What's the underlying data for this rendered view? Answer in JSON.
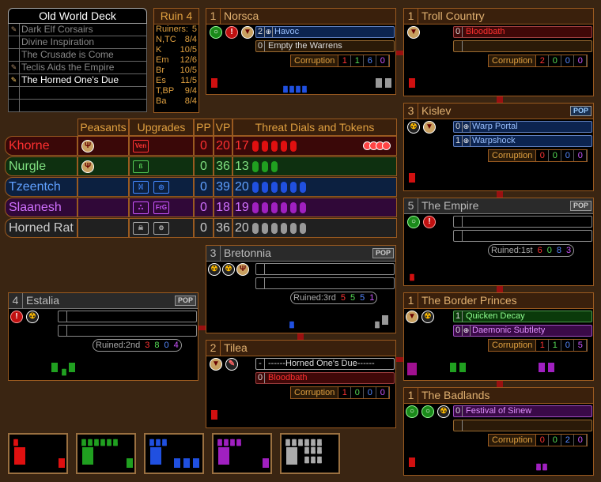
{
  "deck": {
    "title": "Old World Deck",
    "cards": [
      "Dark Elf Corsairs",
      "Divine Inspiration",
      "The Crusade is Come",
      "Teclis Aids the Empire",
      "The Horned One's Due",
      "",
      ""
    ]
  },
  "ruin": {
    "title": "Ruin 4",
    "rows": [
      [
        "Ruiners:",
        "5"
      ],
      [
        "N,TC",
        "8/4"
      ],
      [
        "K",
        "10/5"
      ],
      [
        "Em",
        "12/6"
      ],
      [
        "Br",
        "10/5"
      ],
      [
        "Es",
        "11/5"
      ],
      [
        "T,BP",
        "9/4"
      ],
      [
        "Ba",
        "8/4"
      ]
    ]
  },
  "table": {
    "headers": [
      "Peasants",
      "Upgrades",
      "PP",
      "VP",
      "Threat Dials and Tokens"
    ],
    "rows": [
      {
        "name": "Khorne",
        "pp": "0",
        "vp": "20",
        "threat": "17",
        "color": "#ff3030",
        "bg": "#3a0808",
        "up": [
          "Ven",
          ""
        ]
      },
      {
        "name": "Nurgle",
        "pp": "0",
        "vp": "36",
        "threat": "13",
        "color": "#80e080",
        "bg": "#0e3010",
        "up": [
          "",
          ""
        ]
      },
      {
        "name": "Tzeentch",
        "pp": "0",
        "vp": "39",
        "threat": "20",
        "color": "#60a0ff",
        "bg": "#0c2040",
        "up": [
          "",
          ""
        ]
      },
      {
        "name": "Slaanesh",
        "pp": "0",
        "vp": "18",
        "threat": "19",
        "color": "#d070ff",
        "bg": "#300838",
        "up": [
          "",
          "FrG"
        ]
      },
      {
        "name": "Horned Rat",
        "pp": "0",
        "vp": "36",
        "threat": "20",
        "color": "#cccccc",
        "bg": "#202020",
        "up": [
          "",
          ""
        ]
      }
    ]
  },
  "regions": {
    "norsca": {
      "num": "1",
      "name": "Norsca",
      "slots": [
        {
          "n": "2",
          "t": "Havoc"
        },
        {
          "n": "0",
          "t": "Empty the Warrens"
        }
      ],
      "corr": [
        "1",
        "1",
        "6",
        "0"
      ]
    },
    "troll": {
      "num": "1",
      "name": "Troll Country",
      "slots": [
        {
          "n": "0",
          "t": "Bloodbath"
        },
        {
          "n": "",
          "t": ""
        }
      ],
      "corr": [
        "2",
        "0",
        "0",
        "0"
      ]
    },
    "kislev": {
      "num": "3",
      "name": "Kislev",
      "pop": "POP",
      "slots": [
        {
          "n": "0",
          "t": "Warp Portal"
        },
        {
          "n": "1",
          "t": "Warpshock"
        }
      ],
      "corr": [
        "0",
        "0",
        "0",
        "0"
      ]
    },
    "empire": {
      "num": "5",
      "name": "The Empire",
      "pop": "POP",
      "ruined": "Ruined:1st",
      "rv": [
        "6",
        "0",
        "8",
        "3"
      ]
    },
    "bretonnia": {
      "num": "3",
      "name": "Bretonnia",
      "pop": "POP",
      "ruined": "Ruined:3rd",
      "rv": [
        "5",
        "5",
        "5",
        "1"
      ]
    },
    "estalia": {
      "num": "4",
      "name": "Estalia",
      "pop": "POP",
      "ruined": "Ruined:2nd",
      "rv": [
        "3",
        "8",
        "0",
        "4"
      ]
    },
    "tilea": {
      "num": "2",
      "name": "Tilea",
      "slots": [
        {
          "n": "-",
          "t": "------Horned One's Due------"
        },
        {
          "n": "0",
          "t": "Bloodbath"
        }
      ],
      "corr": [
        "1",
        "0",
        "0",
        "0"
      ]
    },
    "border": {
      "num": "1",
      "name": "The Border Princes",
      "slots": [
        {
          "n": "1",
          "t": "Quicken Decay"
        },
        {
          "n": "0",
          "t": "Daemonic Subtlety"
        }
      ],
      "corr": [
        "1",
        "1",
        "0",
        "5"
      ]
    },
    "badlands": {
      "num": "1",
      "name": "The Badlands",
      "slots": [
        {
          "n": "0",
          "t": "Festival of Sinew"
        },
        {
          "n": "",
          "t": ""
        }
      ],
      "corr": [
        "0",
        "0",
        "2",
        "0"
      ]
    }
  },
  "corruption_label": "Corruption",
  "colors": {
    "khorne": "#e01010",
    "nurgle": "#20a020",
    "tzeentch": "#2050e0",
    "slaanesh": "#a020c0",
    "rat": "#a0a0a0"
  }
}
